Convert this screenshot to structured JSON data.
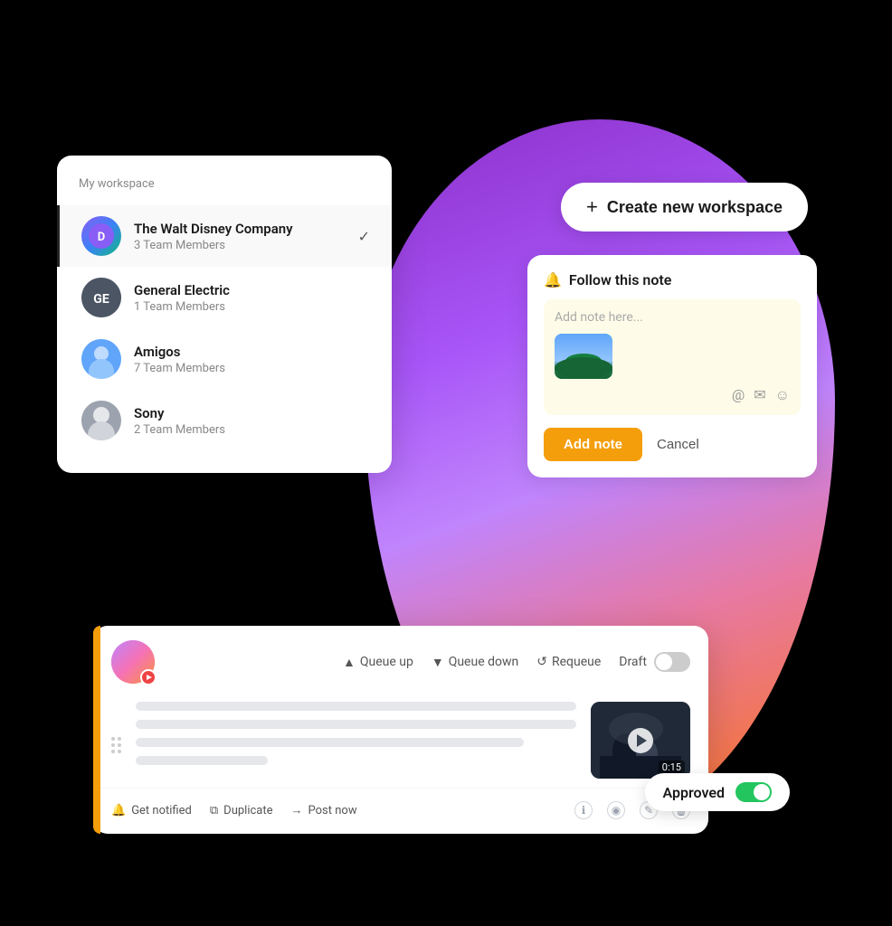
{
  "scene": {
    "background": "#000"
  },
  "workspace_panel": {
    "title": "My workspace",
    "items": [
      {
        "name": "The Walt Disney Company",
        "members": "3 Team Members",
        "active": true,
        "avatar_type": "disney"
      },
      {
        "name": "General Electric",
        "members": "1 Team Members",
        "active": false,
        "avatar_type": "ge"
      },
      {
        "name": "Amigos",
        "members": "7 Team Members",
        "active": false,
        "avatar_type": "amigos"
      },
      {
        "name": "Sony",
        "members": "2 Team Members",
        "active": false,
        "avatar_type": "sony"
      }
    ]
  },
  "create_workspace": {
    "label": "Create new workspace",
    "plus": "+"
  },
  "follow_note": {
    "title": "Follow this note",
    "placeholder": "Add note here...",
    "add_btn": "Add note",
    "cancel_btn": "Cancel"
  },
  "post_card": {
    "queue_up": "Queue up",
    "queue_down": "Queue down",
    "requeue": "Requeue",
    "draft_label": "Draft",
    "get_notified": "Get notified",
    "duplicate": "Duplicate",
    "post_now": "Post now",
    "video_duration": "0:15"
  },
  "approved_badge": {
    "label": "Approved"
  }
}
